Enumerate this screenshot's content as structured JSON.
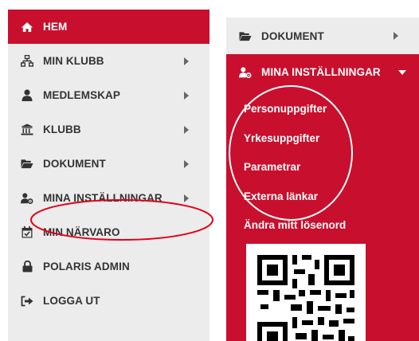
{
  "left_menu": {
    "items": [
      {
        "label": "HEM",
        "icon": "home-icon",
        "active": true,
        "has_arrow": false
      },
      {
        "label": "MIN KLUBB",
        "icon": "sitemap-icon",
        "active": false,
        "has_arrow": true
      },
      {
        "label": "MEDLEMSKAP",
        "icon": "user-icon",
        "active": false,
        "has_arrow": true
      },
      {
        "label": "KLUBB",
        "icon": "institution-icon",
        "active": false,
        "has_arrow": true
      },
      {
        "label": "DOKUMENT",
        "icon": "folder-open-icon",
        "active": false,
        "has_arrow": true
      },
      {
        "label": "MINA INSTÄLLNINGAR",
        "icon": "user-cog-icon",
        "active": false,
        "has_arrow": true
      },
      {
        "label": "MIN NÄRVARO",
        "icon": "calendar-check-icon",
        "active": false,
        "has_arrow": false
      },
      {
        "label": "POLARIS ADMIN",
        "icon": "lock-icon",
        "active": false,
        "has_arrow": false
      },
      {
        "label": "LOGGA UT",
        "icon": "sign-out-icon",
        "active": false,
        "has_arrow": false
      }
    ]
  },
  "right_menu": {
    "dokument": {
      "label": "DOKUMENT",
      "icon": "folder-open-icon"
    },
    "settings": {
      "label": "MINA INSTÄLLNINGAR",
      "icon": "user-cog-icon",
      "expanded": true
    },
    "submenu": [
      {
        "label": "Personuppgifter"
      },
      {
        "label": "Yrkesuppgifter"
      },
      {
        "label": "Parametrar"
      },
      {
        "label": "Externa länkar"
      },
      {
        "label": "Ändra mitt lösenord"
      }
    ]
  },
  "colors": {
    "accent": "#c8102e",
    "panel_bg": "#ececec",
    "text": "#333333",
    "annotation_red": "#e4001b",
    "annotation_white": "#ffffff"
  }
}
